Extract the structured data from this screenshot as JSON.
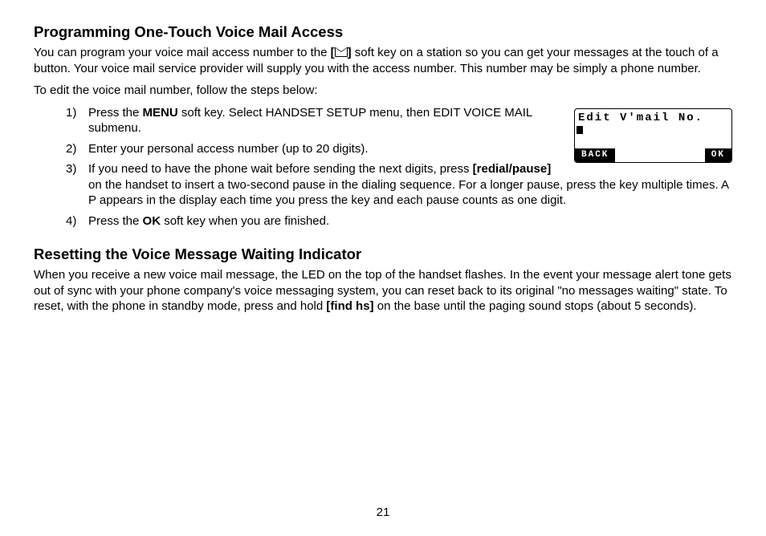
{
  "section1": {
    "heading": "Programming One-Touch Voice Mail Access",
    "intro_before_icon": "You can program your voice mail access number to the ",
    "icon_open_bracket": "[",
    "icon_close_bracket": "]",
    "intro_after_icon": " soft key on a station so you can get your messages at the touch of a button. Your voice mail service provider will supply you with the access number. This number may be simply a phone number.",
    "steps_intro": "To edit the voice mail number, follow the steps below:",
    "steps": {
      "s1_pre": "Press the ",
      "s1_bold": "MENU",
      "s1_post": " soft key. Select HANDSET SETUP menu, then EDIT VOICE MAIL submenu.",
      "s2": "Enter your personal access number (up to 20 digits).",
      "s3_pre": "If you need to have the phone wait before sending the next digits, press ",
      "s3_bold": "[redial/pause]",
      "s3_post": " on the handset to insert a two-second pause in the dialing sequence. For a longer pause, press the key multiple times. A P appears in the display each time you press the key and each pause counts as one digit.",
      "s4_pre": "Press the ",
      "s4_bold": "OK",
      "s4_post": " soft key when you are finished."
    }
  },
  "lcd": {
    "title_line": "Edit V'mail No.",
    "soft_back": "BACK",
    "soft_ok": "OK"
  },
  "section2": {
    "heading": "Resetting the Voice Message Waiting Indicator",
    "para_pre": "When you receive a new voice mail message, the LED on the top of the handset flashes. In the event your message alert tone gets out of sync with your phone company's voice messaging system, you can reset back to its original \"no messages waiting\" state. To reset, with the phone in standby mode, press and hold ",
    "para_bold": "[find hs]",
    "para_post": " on the base until the paging sound stops (about 5 seconds)."
  },
  "page_number": "21"
}
